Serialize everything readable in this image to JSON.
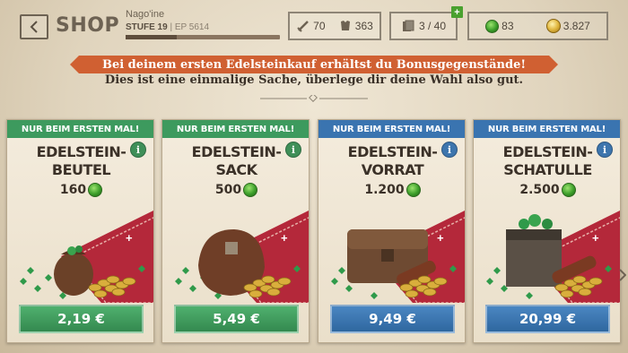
{
  "header": {
    "back_label": "<",
    "title": "SHOP",
    "player_name": "Nago'ine",
    "level": "STUFE 19",
    "ep": "EP 5614",
    "xp_progress": 0.33
  },
  "stats": {
    "attack": "70",
    "defense": "363",
    "cards": "3 / 40",
    "gems": "83",
    "gold": "3.827",
    "plus_label": "+"
  },
  "banner": {
    "headline": "Bei deinem ersten Edelsteinkauf erhältst du Bonusgegenstände!",
    "subline": "Dies ist eine einmalige Sache, überlege dir deine Wahl also gut."
  },
  "offers": [
    {
      "ribbon": "NUR BEIM ERSTEN MAL!",
      "title_line1": "EDELSTEIN-",
      "title_line2": "BEUTEL",
      "amount": "160",
      "price": "2,19 €",
      "color": "green",
      "icon": "gem-pouch"
    },
    {
      "ribbon": "NUR BEIM ERSTEN MAL!",
      "title_line1": "EDELSTEIN-",
      "title_line2": "SACK",
      "amount": "500",
      "price": "5,49 €",
      "color": "green",
      "icon": "gem-sack"
    },
    {
      "ribbon": "NUR BEIM ERSTEN MAL!",
      "title_line1": "EDELSTEIN-",
      "title_line2": "VORRAT",
      "amount": "1.200",
      "price": "9,49 €",
      "color": "blue",
      "icon": "gem-chest"
    },
    {
      "ribbon": "NUR BEIM ERSTEN MAL!",
      "title_line1": "EDELSTEIN-",
      "title_line2": "SCHATULLE",
      "amount": "2.500",
      "price": "20,99 €",
      "color": "blue",
      "icon": "gem-casket"
    }
  ],
  "info_label": "i",
  "colors": {
    "green": "#3d9a5e",
    "blue": "#3a74b0",
    "banner": "#d06032"
  }
}
